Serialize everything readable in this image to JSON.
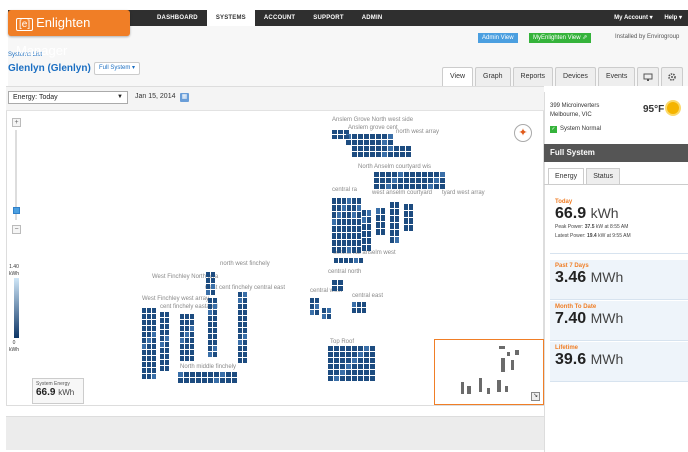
{
  "header": {
    "logo_mark": "[e]",
    "logo_text": "Enlighten Manager",
    "nav": [
      "DASHBOARD",
      "SYSTEMS",
      "ACCOUNT",
      "SUPPORT",
      "ADMIN"
    ],
    "active_nav": "SYSTEMS",
    "my_account": "My Account ▾",
    "help": "Help ▾"
  },
  "subheader": {
    "admin_view": "Admin View",
    "myenlighten_view": "MyEnlighten View ⇗",
    "installed_by": "Installed by Envirogroup",
    "breadcrumb": "Systems List",
    "site_title": "Glenlyn (Glenlyn)",
    "full_system_dropdown": "Full System ▾"
  },
  "tabs": [
    "View",
    "Graph",
    "Reports",
    "Devices",
    "Events"
  ],
  "active_tab": "View",
  "controls": {
    "energy_select": "Energy: Today",
    "date": "Jan 15, 2014"
  },
  "legend": {
    "max": "1.40",
    "max_unit": "kWh",
    "min": "0",
    "min_unit": "kWh",
    "max_color": "#0c3566",
    "min_color": "#cfe6f7"
  },
  "system_energy": {
    "label": "System Energy",
    "value": "66.9",
    "unit": "kWh"
  },
  "arrays": [
    "Anslem Grove North west side",
    "Anslem grove cent",
    "north west array",
    "North Anselm courtyard wis",
    "central ra",
    "west anselm courtyard",
    "tyard west array",
    "central flat anselm west",
    "central north",
    "central east",
    "central west",
    "north west finchely",
    "West Finchley North arra",
    "west cent finchely central east",
    "West Finchley west array",
    "cent finchely eastappl",
    "North middle finchely",
    "Top Roof"
  ],
  "weather": {
    "microinverters": "399 Microinverters",
    "location": "Melbourne, VIC",
    "temperature": "95°F",
    "status": "System Normal"
  },
  "sidebar": {
    "header": "Full System",
    "tabs": [
      "Energy",
      "Status"
    ],
    "active_tab": "Energy",
    "today": {
      "title": "Today",
      "value": "66.9",
      "unit": "kWh",
      "peak_label": "Peak Power:",
      "peak_value": "37.5",
      "peak_unit_time": "kW at 8:55 AM",
      "latest_label": "Latest Power:",
      "latest_value": "19.4",
      "latest_unit_time": "kW at 9:55 AM"
    },
    "past7": {
      "title": "Past 7 Days",
      "value": "3.46",
      "unit": "MWh"
    },
    "mtd": {
      "title": "Month To Date",
      "value": "7.40",
      "unit": "MWh"
    },
    "lifetime": {
      "title": "Lifetime",
      "value": "39.6",
      "unit": "MWh"
    }
  },
  "colors": {
    "brand_orange": "#f07e26",
    "panel_dark": "#1d4c80",
    "link_blue": "#1a6ec2",
    "admin_blue": "#4b9fe0",
    "myenlighten_green": "#35b33b"
  }
}
